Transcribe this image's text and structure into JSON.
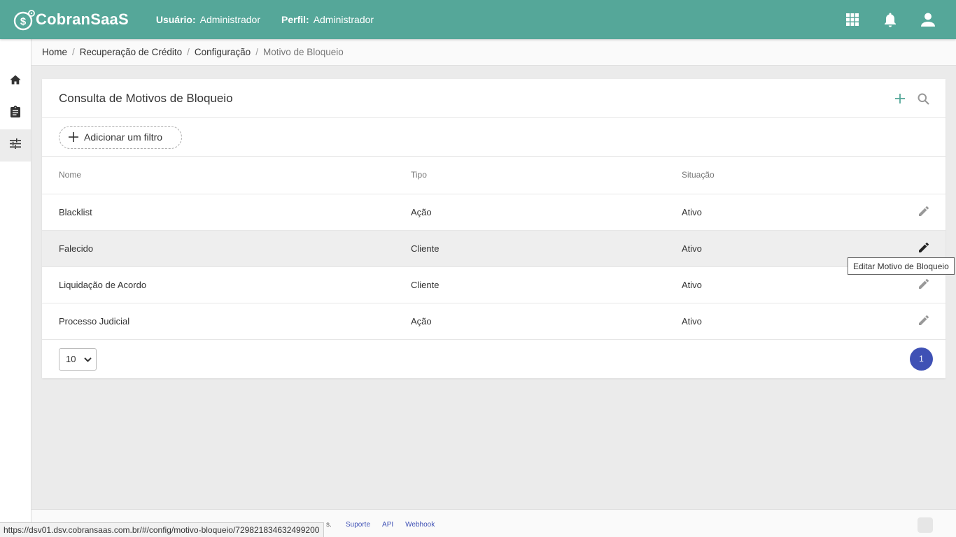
{
  "app": {
    "brand": "CobranSaaS",
    "user_label": "Usuário:",
    "user_value": "Administrador",
    "profile_label": "Perfil:",
    "profile_value": "Administrador",
    "colors": {
      "topbar": "#55a799",
      "accent": "#3f51b5",
      "add": "#55a799"
    }
  },
  "breadcrumb": {
    "items": [
      "Home",
      "Recuperação de Crédito",
      "Configuração"
    ],
    "current": "Motivo de Bloqueio"
  },
  "sidebar": {
    "icons": [
      "home-icon",
      "clipboard-icon",
      "tune-icon"
    ]
  },
  "page": {
    "title": "Consulta de Motivos de Bloqueio",
    "filter_button": "Adicionar um filtro"
  },
  "table": {
    "columns": [
      "Nome",
      "Tipo",
      "Situação"
    ],
    "rows": [
      {
        "nome": "Blacklist",
        "tipo": "Ação",
        "situacao": "Ativo"
      },
      {
        "nome": "Falecido",
        "tipo": "Cliente",
        "situacao": "Ativo"
      },
      {
        "nome": "Liquidação de Acordo",
        "tipo": "Cliente",
        "situacao": "Ativo"
      },
      {
        "nome": "Processo Judicial",
        "tipo": "Ação",
        "situacao": "Ativo"
      }
    ]
  },
  "pagination": {
    "page_size": "10",
    "current_page": "1"
  },
  "tooltip": "Editar Motivo de Bloqueio",
  "footer": {
    "tail": "s.",
    "links": [
      "Suporte",
      "API",
      "Webhook"
    ]
  },
  "status_url": "https://dsv01.dsv.cobransaas.com.br/#/config/motivo-bloqueio/729821834632499200"
}
